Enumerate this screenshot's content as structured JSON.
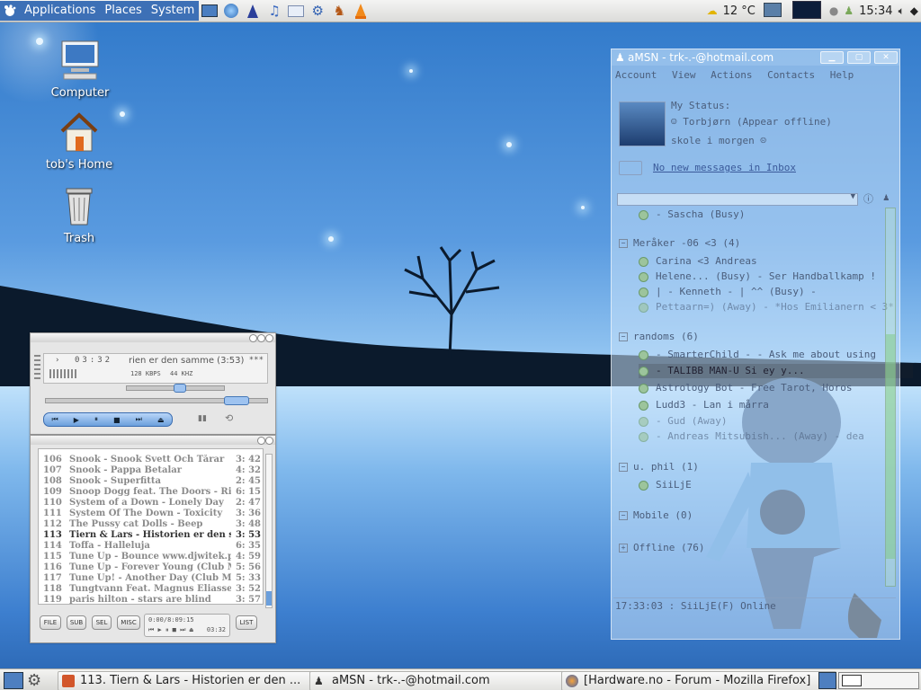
{
  "top_panel": {
    "menus": [
      "Applications",
      "Places",
      "System"
    ],
    "launchers": [
      "terminal-launcher",
      "web-browser-launcher",
      "wizard-launcher",
      "music-player-launcher",
      "mail-launcher",
      "tool-launcher",
      "game-launcher",
      "vlc-launcher"
    ],
    "weather": "12 °C",
    "clock": "15:34"
  },
  "desktop": {
    "icons": [
      {
        "label": "Computer"
      },
      {
        "label": "tob's Home"
      },
      {
        "label": "Trash"
      }
    ]
  },
  "winamp": {
    "time": "03:32",
    "track_scroll": "rien er den samme (3:53)",
    "scroll_marker": "***",
    "bitrate": "128 KBPS",
    "samplerate": "44 KHZ",
    "playlist": [
      {
        "num": "106",
        "title": "Snook - Snook Svett Och Tårar",
        "time": "3: 42"
      },
      {
        "num": "107",
        "title": "Snook - Pappa Betalar",
        "time": "4: 32"
      },
      {
        "num": "108",
        "title": "Snook - Superfitta",
        "time": "2: 45"
      },
      {
        "num": "109",
        "title": "Snoop Dogg feat. The Doors - Riders",
        "time": "6: 15"
      },
      {
        "num": "110",
        "title": "System of a Down - Lonely Day",
        "time": "2: 47"
      },
      {
        "num": "111",
        "title": "System Of The Down - Toxicity",
        "time": "3: 36"
      },
      {
        "num": "112",
        "title": "The Pussy cat Dolls - Beep",
        "time": "3: 48"
      },
      {
        "num": "113",
        "title": "Tiern & Lars - Historien er den samme",
        "time": "3: 53"
      },
      {
        "num": "114",
        "title": "Toffa - Halleluja",
        "time": "6: 35"
      },
      {
        "num": "115",
        "title": "Tune Up - Bounce  www.djwitek.prv.",
        "time": "4: 59"
      },
      {
        "num": "116",
        "title": "Tune Up - Forever Young (Club Mix)",
        "time": "5: 56"
      },
      {
        "num": "117",
        "title": "Tune Up! - Another Day (Club Mix) (",
        "time": "5: 33"
      },
      {
        "num": "118",
        "title": "Tungtvann Feat. Magnus Eliasse - 2",
        "time": "3: 52"
      },
      {
        "num": "119",
        "title": "paris hilton - stars are blind",
        "time": "3: 57"
      }
    ],
    "buttons": {
      "file": "FILE",
      "sub": "SUB",
      "sel": "SEL",
      "misc": "MISC",
      "list": "LIST"
    },
    "total_time": "0:00/8:09:15",
    "mini_time": "03:32"
  },
  "amsn": {
    "title": "aMSN - trk-.-@hotmail.com",
    "menus": [
      "Account",
      "View",
      "Actions",
      "Contacts",
      "Help"
    ],
    "status_label": "My Status:",
    "nick": "Torbjørn",
    "status": "(Appear offline)",
    "psm": "skole i morgen",
    "inbox": "No new messages in Inbox",
    "contacts": [
      {
        "name": "- Sascha  (Busy)"
      }
    ],
    "groups": [
      {
        "label": "Meråker -06 <3 (4)",
        "contacts": [
          "Carina <3 Andreas",
          "Helene...  (Busy) - Ser Handballkamp !",
          "|  -   Kenneth   -  |  ^^  (Busy) -",
          "Pettaarn=)  (Away) - *Hos Emilianern < 3*"
        ]
      },
      {
        "label": "randoms (6)",
        "contacts": [
          "- SmarterChild  -  - Ask me about using",
          "- TALIBB MAN-U   Si ey y...",
          "Astrology Bot  - Free Tarot, Horos",
          "Ludd3  - Lan i mårra",
          "- Gud  (Away)",
          "- Andreas  Mitsubish...  (Away) - dea"
        ]
      },
      {
        "label": "u. phil (1)",
        "contacts": [
          "SiiLjE"
        ]
      },
      {
        "label": "Mobile (0)",
        "contacts": []
      },
      {
        "label": "Offline (76)",
        "contacts": []
      }
    ],
    "status_bar": "17:33:03 : SiiLjE(F) Online"
  },
  "taskbar": {
    "tasks": [
      {
        "label": "113. Tiern & Lars - Historien er den ..."
      },
      {
        "label": "aMSN - trk-.-@hotmail.com"
      },
      {
        "label": "[Hardware.no - Forum - Mozilla Firefox]"
      }
    ]
  }
}
